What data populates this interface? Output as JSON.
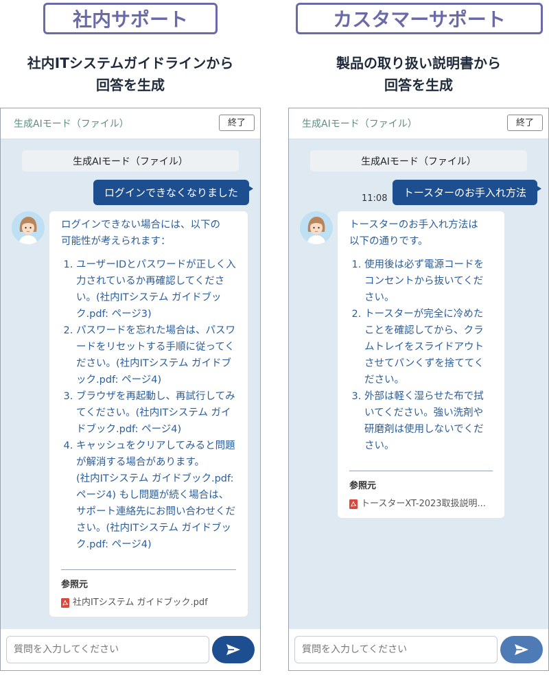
{
  "left": {
    "title": "社内サポート",
    "desc_line1": "社内ITシステムガイドラインから",
    "desc_line2": "回答を生成",
    "header": {
      "mode_label": "生成AIモード（ファイル）",
      "end_label": "終了"
    },
    "mode_pill": "生成AIモード（ファイル）",
    "user_message": "ログインできなくなりました",
    "bot": {
      "intro_line1": "ログインできない場合には、以下の",
      "intro_line2": "可能性が考えられます：",
      "items": [
        "ユーザーIDとパスワードが正しく入力されているか再確認してください。(社内ITシステム ガイドブック.pdf: ページ3)",
        "パスワードを忘れた場合は、パスワードをリセットする手順に従ってください。(社内ITシステム ガイドブック.pdf: ページ4)",
        "ブラウザを再起動し、再試行してみてください。(社内ITシステム ガイドブック.pdf: ページ4)",
        "キャッシュをクリアしてみると問題が解消する場合があります。"
      ],
      "extra": "(社内ITシステム ガイドブック.pdf: ページ4) もし問題が続く場合は、サポート連絡先にお問い合わせください。(社内ITシステム ガイドブック.pdf: ページ4)",
      "ref_label": "参照元",
      "ref_file": "社内ITシステム ガイドブック.pdf"
    },
    "input_placeholder": "質問を入力してください"
  },
  "right": {
    "title": "カスタマーサポート",
    "desc_line1": "製品の取り扱い説明書から",
    "desc_line2": "回答を生成",
    "header": {
      "mode_label": "生成AIモード（ファイル）",
      "end_label": "終了"
    },
    "mode_pill": "生成AIモード（ファイル）",
    "timestamp": "11:08",
    "user_message": "トースターのお手入れ方法",
    "bot": {
      "intro_line1": "トースターのお手入れ方法は",
      "intro_line2": "以下の通りです。",
      "items": [
        "使用後は必ず電源コードをコンセントから抜いてください。",
        "トースターが完全に冷めたことを確認してから、クラムトレイをスライドアウトさせてパンくずを捨ててください。",
        "外部は軽く湿らせた布で拭いてください。強い洗剤や研磨剤は使用しないでください。"
      ],
      "ref_label": "参照元",
      "ref_file": "トースターXT-2023取扱説明..."
    },
    "input_placeholder": "質問を入力してください"
  },
  "colors": {
    "title_border": "#6b6aa8",
    "chat_bg": "#dfe9f2",
    "user_bubble": "#1d4e8f",
    "bot_text": "#2b5d9a",
    "mode_label": "#5b8f82",
    "pdf_icon": "#d9483b"
  },
  "icons": {
    "send": "send-arrow-icon",
    "pdf": "pdf-file-icon",
    "avatar": "assistant-avatar-icon"
  }
}
